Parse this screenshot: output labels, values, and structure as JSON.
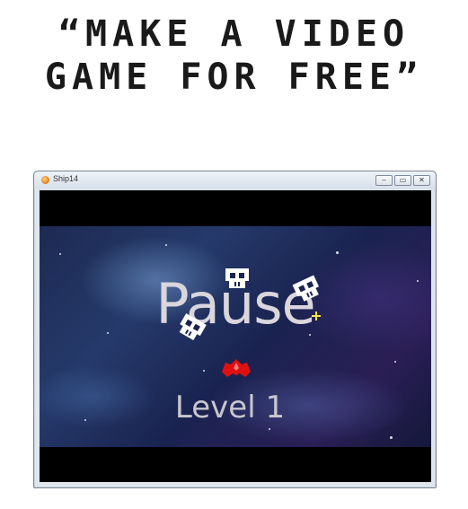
{
  "headline": {
    "line1": "“Make a Video",
    "line2": "Game for Free”"
  },
  "window": {
    "title": "Ship14",
    "app_icon": "flame-app-icon",
    "controls": {
      "minimize_icon": "minimize-icon",
      "maximize_icon": "maximize-icon",
      "close_icon": "close-icon"
    }
  },
  "game": {
    "pause_label": "Pause",
    "level_label": "Level 1",
    "sprites": [
      "skull-enemy-icon",
      "skull-enemy-icon",
      "skull-enemy-icon",
      "player-ship-icon",
      "sparkle-icon"
    ]
  },
  "colors": {
    "letterbox": "#000000",
    "ship": "#e01010",
    "skull": "#ffffff",
    "sparkle": "#ffe14a"
  }
}
